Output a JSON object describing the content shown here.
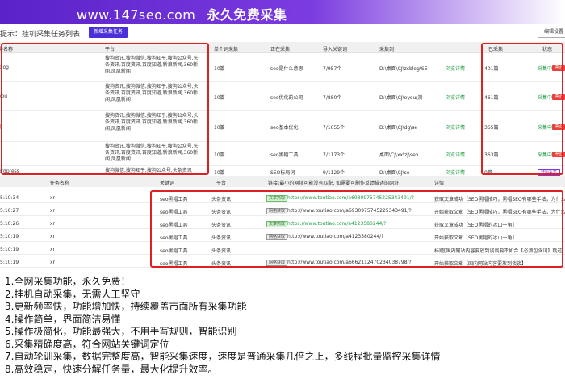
{
  "banner": {
    "site": "www.147seo.com",
    "slogan": "永久免费采集"
  },
  "hint": {
    "label": "提示：挂机采集任务列表",
    "new_task": "新增采集任务",
    "right_button": "编辑设置"
  },
  "task_table": {
    "headers": [
      "任务名称",
      "平台",
      "单个词采集",
      "正在采集",
      "导入关键词",
      "采集到",
      "已采集",
      "状态"
    ],
    "rows": [
      {
        "name": "blog",
        "platform": "搜狗资讯,搜狗微信,搜狗知乎,搜狗公众号,头条资讯,百度资讯,百度知道,新浪新闻,360新闻,凤凰新闻",
        "single": "10篇",
        "current": "seo是什么意思",
        "imported": "7/957个",
        "path": "D:\\桌面\\CJ\\zsblog\\SE",
        "view": "浏览详情",
        "collected": "401篇",
        "status": "采集中",
        "stop": "停止"
      },
      {
        "name": "you",
        "platform": "搜狗资讯,搜狗微信,搜狗知乎,搜狗公众号,头条资讯,百度资讯,百度知道,新浪新闻,360新闻,凤凰新闻",
        "single": "10篇",
        "current": "seo优化的公司",
        "imported": "7/880个",
        "path": "D:\\桌面\\CJ\\eyou\\测",
        "view": "浏览详情",
        "collected": "461篇",
        "status": "采集中",
        "stop": "停止"
      },
      {
        "name": "g",
        "platform": "搜狗资讯,搜狗微信,搜狗知乎,搜狗公众号,头条资讯,百度资讯,百度知道,新浪新闻,360新闻,凤凰新闻",
        "single": "10篇",
        "current": "seo基本优化",
        "imported": "7/1055个",
        "path": "D:\\桌面\\CJ\\dg\\se",
        "view": "浏览详情",
        "collected": "365篇",
        "status": "采集中",
        "stop": "停止"
      },
      {
        "name": "r",
        "platform": "搜狗资讯,搜狗微信,搜狗知乎,搜狗公众号,头条资讯,百度资讯,百度知道,新浪新闻,360新闻,凤凰新闻",
        "single": "10篇",
        "current": "seo黑帽工具",
        "imported": "7/1173个",
        "path": "桌面\\CJ\\xx\\zj\\seo",
        "view": "浏览详情",
        "collected": "363篇",
        "status": "采集中",
        "stop": "停止"
      },
      {
        "name": "ordpress",
        "platform": "搜狗微信,搜狗知乎,搜狗公众号,头条资讯",
        "single": "10篇",
        "current": "SEO标局词",
        "imported": "9/1129个",
        "path": "D:\\桌面\\CJ\\se",
        "view": "浏览详情",
        "collected": "0篇",
        "status": "",
        "stop": "开始采集"
      }
    ]
  },
  "log_table": {
    "headers": [
      "",
      "任务名称",
      "关键词",
      "平台",
      "链接(最小的网址可能没有匹配, 如需要可删作反馈描述的网址)",
      "详情"
    ],
    "rows": [
      {
        "time": "5:10:34",
        "task": "xr",
        "keyword": "seo黑帽工具",
        "platform": "头条资讯",
        "badge": "文章抓取",
        "badge_type": "green",
        "url": "https://www.toutiao.com/a6930975745225343491/?",
        "detail": "获取文章成功【SEO黑帽技巧，黑帽SEO有哪些手法，为什么要避"
      },
      {
        "time": "5:10:27",
        "task": "xr",
        "keyword": "seo黑帽工具",
        "platform": "头条资讯",
        "badge": "网络获取",
        "badge_type": "gray",
        "url": "http://www.toutiao.com/a6930975745225343491/?",
        "detail": "开始获取文章【SEO黑帽技巧，黑帽SEO有哪些手法，为什么要避"
      },
      {
        "time": "5:10:26",
        "task": "xr",
        "keyword": "seo黑帽工具",
        "platform": "头条资讯",
        "badge": "文章抓取",
        "badge_type": "green",
        "url": "https://www.toutiao.com/a4123580244/?",
        "detail": "获取文章成功【SEO黑帽的冰山一角】"
      },
      {
        "time": "5:10:19",
        "task": "xr",
        "keyword": "seo黑帽工具",
        "platform": "头条资讯",
        "badge": "网络获取",
        "badge_type": "gray",
        "url": "http://www.toutiao.com/a4123580244/?",
        "detail": "开始获取文章【SEO黑帽的冰山一角】"
      },
      {
        "time": "5:10:19",
        "task": "xr",
        "keyword": "seo黑帽工具",
        "platform": "头条资讯",
        "badge": "",
        "badge_type": "",
        "url": "",
        "detail": "标题[国内网站内容要放到谈谈要不如合【必须包含词】跳过"
      },
      {
        "time": "5:10:19",
        "task": "xr",
        "keyword": "seo黑帽工具",
        "platform": "头条资讯",
        "badge": "网络获取",
        "badge_type": "gray",
        "url": "http://www.toutiao.com/a6662112470234038798/?",
        "detail": "开始获取文章【国内网站内容要放到谈谈】"
      }
    ]
  },
  "features": [
    "1.全网采集功能，永久免费！",
    "2.挂机自动采集，无需人工坚守",
    "3.更新频率快，功能增加快，持续覆盖市面所有采集功能",
    "4.操作简单，界面简洁易懂",
    "5.操作极简化，功能最强大，不用手写规则，智能识别",
    "6.采集精确度高，符合网站关键词定位",
    "7.自动轮训采集，数据完整度高，智能采集速度，速度是普通采集几倍之上，多线程批量监控采集详情",
    "8.高效稳定，快速分解任务量，最大化提升效率。"
  ],
  "colors": {
    "banner": "#5a22c9",
    "highlight": "#e02020",
    "accent": "#4b2fd8",
    "ok": "#1e9b43"
  }
}
